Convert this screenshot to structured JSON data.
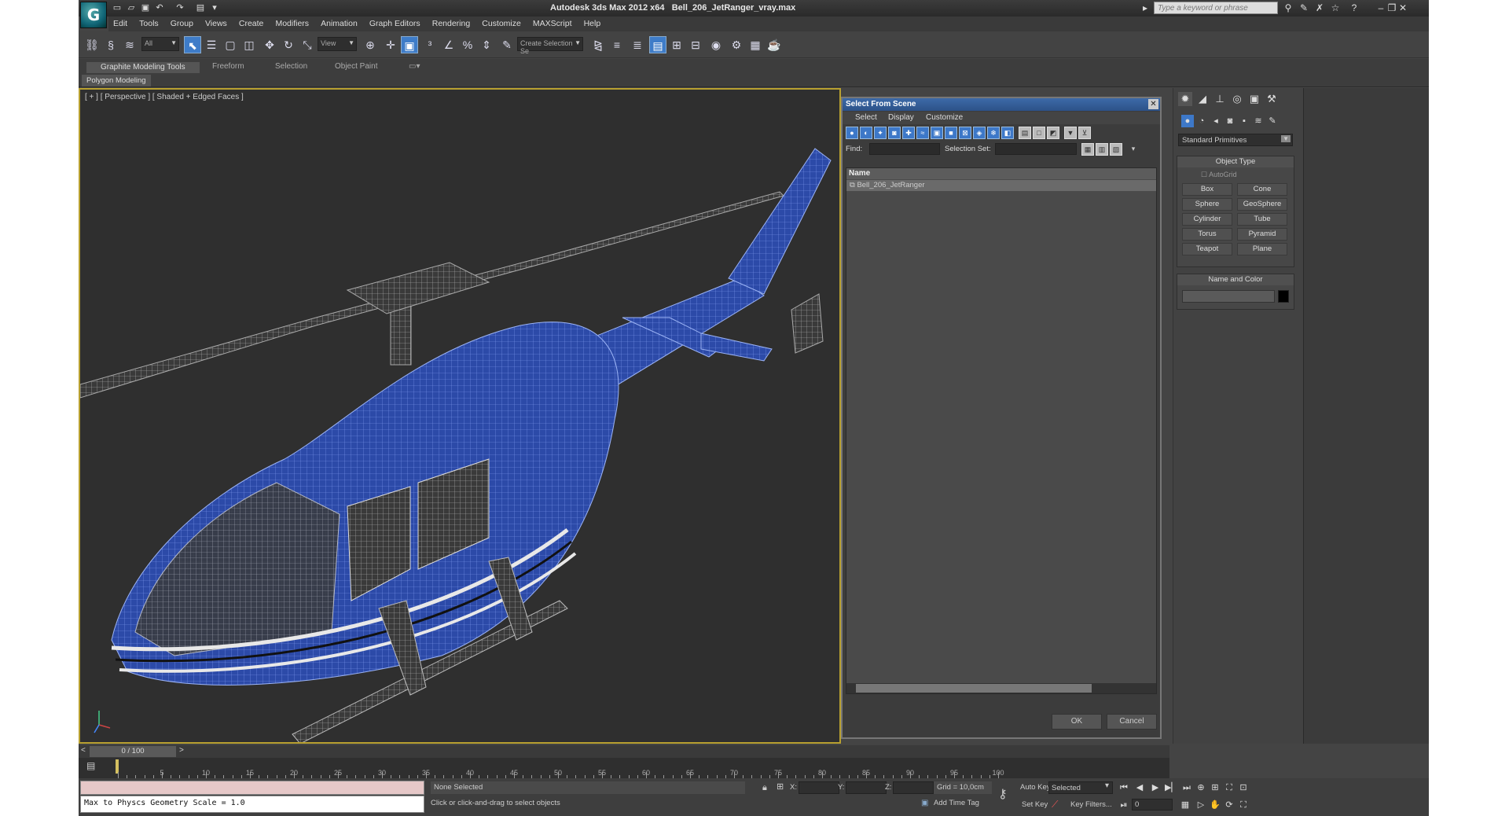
{
  "window": {
    "app_title": "Autodesk 3ds Max  2012 x64",
    "file_name": "Bell_206_JetRanger_vray.max",
    "search_placeholder": "Type a keyword or phrase"
  },
  "menu": [
    "Edit",
    "Tools",
    "Group",
    "Views",
    "Create",
    "Modifiers",
    "Animation",
    "Graph Editors",
    "Rendering",
    "Customize",
    "MAXScript",
    "Help"
  ],
  "toolbar": {
    "filter_value": "All",
    "ref_coord_value": "View",
    "selection_set_value": "Create Selection Se"
  },
  "ribbon": {
    "tabs": [
      "Graphite Modeling Tools",
      "Freeform",
      "Selection",
      "Object Paint"
    ],
    "sub_label": "Polygon Modeling"
  },
  "viewport": {
    "label": "[ + ] [ Perspective ] [ Shaded + Edged Faces ]",
    "model_color": "#2c4aa8"
  },
  "dialog": {
    "title": "Select From Scene",
    "menu": [
      "Select",
      "Display",
      "Customize"
    ],
    "find_label": "Find:",
    "selection_set_label": "Selection Set:",
    "column_name": "Name",
    "items": [
      "Bell_206_JetRanger"
    ],
    "ok_label": "OK",
    "cancel_label": "Cancel"
  },
  "command_panel": {
    "category_value": "Standard Primitives",
    "object_type_title": "Object Type",
    "autogrid_label": "AutoGrid",
    "primitives": [
      "Box",
      "Cone",
      "Sphere",
      "GeoSphere",
      "Cylinder",
      "Tube",
      "Torus",
      "Pyramid",
      "Teapot",
      "Plane"
    ],
    "name_color_title": "Name and Color",
    "object_color": "#000000"
  },
  "timeline": {
    "frame_display": "0 / 100",
    "ticks": [
      "5",
      "10",
      "15",
      "20",
      "25",
      "30",
      "35",
      "40",
      "45",
      "50",
      "55",
      "60",
      "65",
      "70",
      "75",
      "80",
      "85",
      "90",
      "95",
      "100"
    ]
  },
  "status": {
    "maxscript_output": "Max to Physcs Geometry Scale = 1.0",
    "selection_status": "None Selected",
    "prompt": "Click or click-and-drag to select objects",
    "x_label": "X:",
    "y_label": "Y:",
    "z_label": "Z:",
    "grid": "Grid = 10,0cm",
    "add_time_tag": "Add Time Tag",
    "auto_key": "Auto Key",
    "set_key": "Set Key",
    "selected_value": "Selected",
    "key_filters": "Key Filters...",
    "current_frame": "0"
  }
}
